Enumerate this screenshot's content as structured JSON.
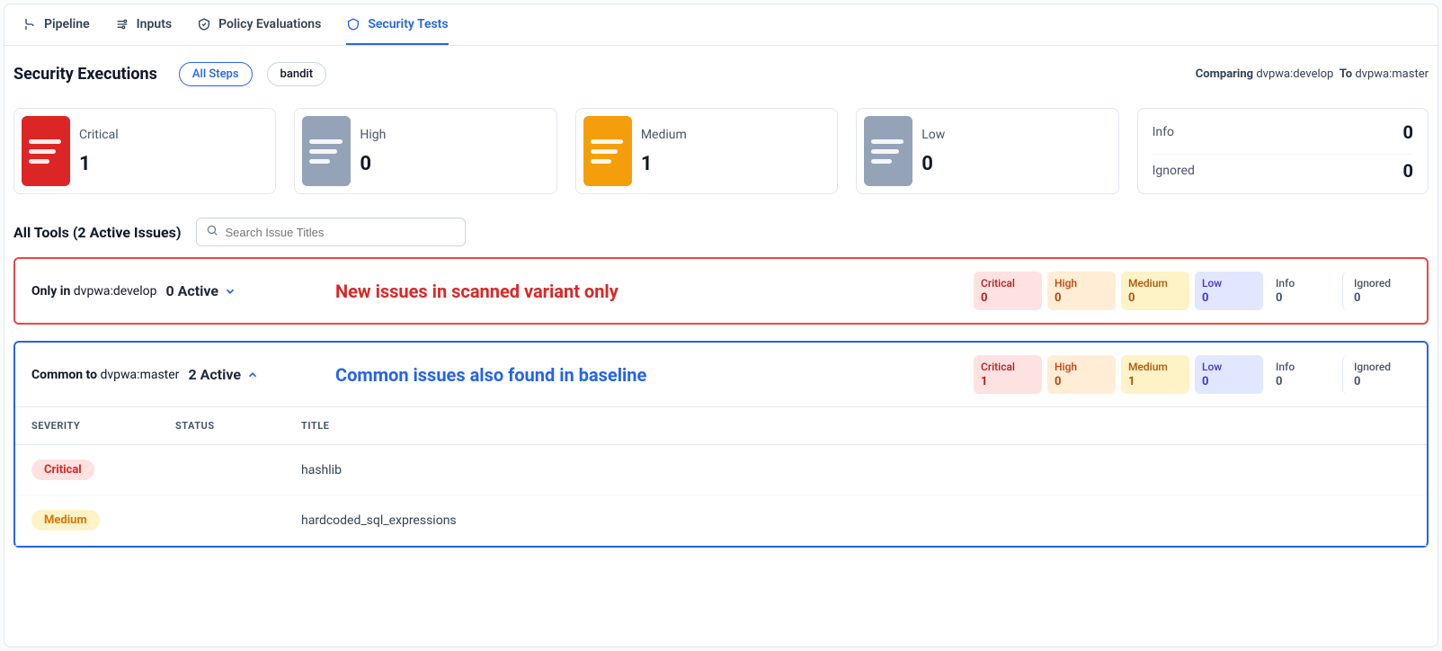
{
  "tabs": [
    {
      "label": "Pipeline"
    },
    {
      "label": "Inputs"
    },
    {
      "label": "Policy Evaluations"
    },
    {
      "label": "Security Tests",
      "active": true
    }
  ],
  "header": {
    "title": "Security Executions",
    "filters": {
      "all_steps": "All Steps",
      "bandit": "bandit"
    },
    "compare_label": "Comparing",
    "compare_from": "dvpwa:develop",
    "compare_to_label": "To",
    "compare_to": "dvpwa:master"
  },
  "summary": {
    "critical": {
      "label": "Critical",
      "value": "1",
      "color": "#dc2626"
    },
    "high": {
      "label": "High",
      "value": "0",
      "color": "#94a3b8"
    },
    "medium": {
      "label": "Medium",
      "value": "1",
      "color": "#f59e0b"
    },
    "low": {
      "label": "Low",
      "value": "0",
      "color": "#94a3b8"
    },
    "info": {
      "label": "Info",
      "value": "0"
    },
    "ignored": {
      "label": "Ignored",
      "value": "0"
    }
  },
  "tools": {
    "title": "All Tools (2 Active Issues)",
    "search_placeholder": "Search Issue Titles"
  },
  "groups": {
    "only": {
      "prefix": "Only in",
      "target": "dvpwa:develop",
      "active_count": "0 Active",
      "message": "New issues in scanned variant only",
      "sev": {
        "critical": {
          "label": "Critical",
          "value": "0"
        },
        "high": {
          "label": "High",
          "value": "0"
        },
        "medium": {
          "label": "Medium",
          "value": "0"
        },
        "low": {
          "label": "Low",
          "value": "0"
        },
        "info": {
          "label": "Info",
          "value": "0"
        },
        "ignored": {
          "label": "Ignored",
          "value": "0"
        }
      }
    },
    "common": {
      "prefix": "Common to",
      "target": "dvpwa:master",
      "active_count": "2 Active",
      "message": "Common issues also found in baseline",
      "sev": {
        "critical": {
          "label": "Critical",
          "value": "1"
        },
        "high": {
          "label": "High",
          "value": "0"
        },
        "medium": {
          "label": "Medium",
          "value": "1"
        },
        "low": {
          "label": "Low",
          "value": "0"
        },
        "info": {
          "label": "Info",
          "value": "0"
        },
        "ignored": {
          "label": "Ignored",
          "value": "0"
        }
      },
      "columns": {
        "severity": "SEVERITY",
        "status": "STATUS",
        "title": "TITLE"
      },
      "rows": [
        {
          "severity_label": "Critical",
          "severity_class": "critical",
          "status": "",
          "title": "hashlib"
        },
        {
          "severity_label": "Medium",
          "severity_class": "medium",
          "status": "",
          "title": "hardcoded_sql_expressions"
        }
      ]
    }
  }
}
